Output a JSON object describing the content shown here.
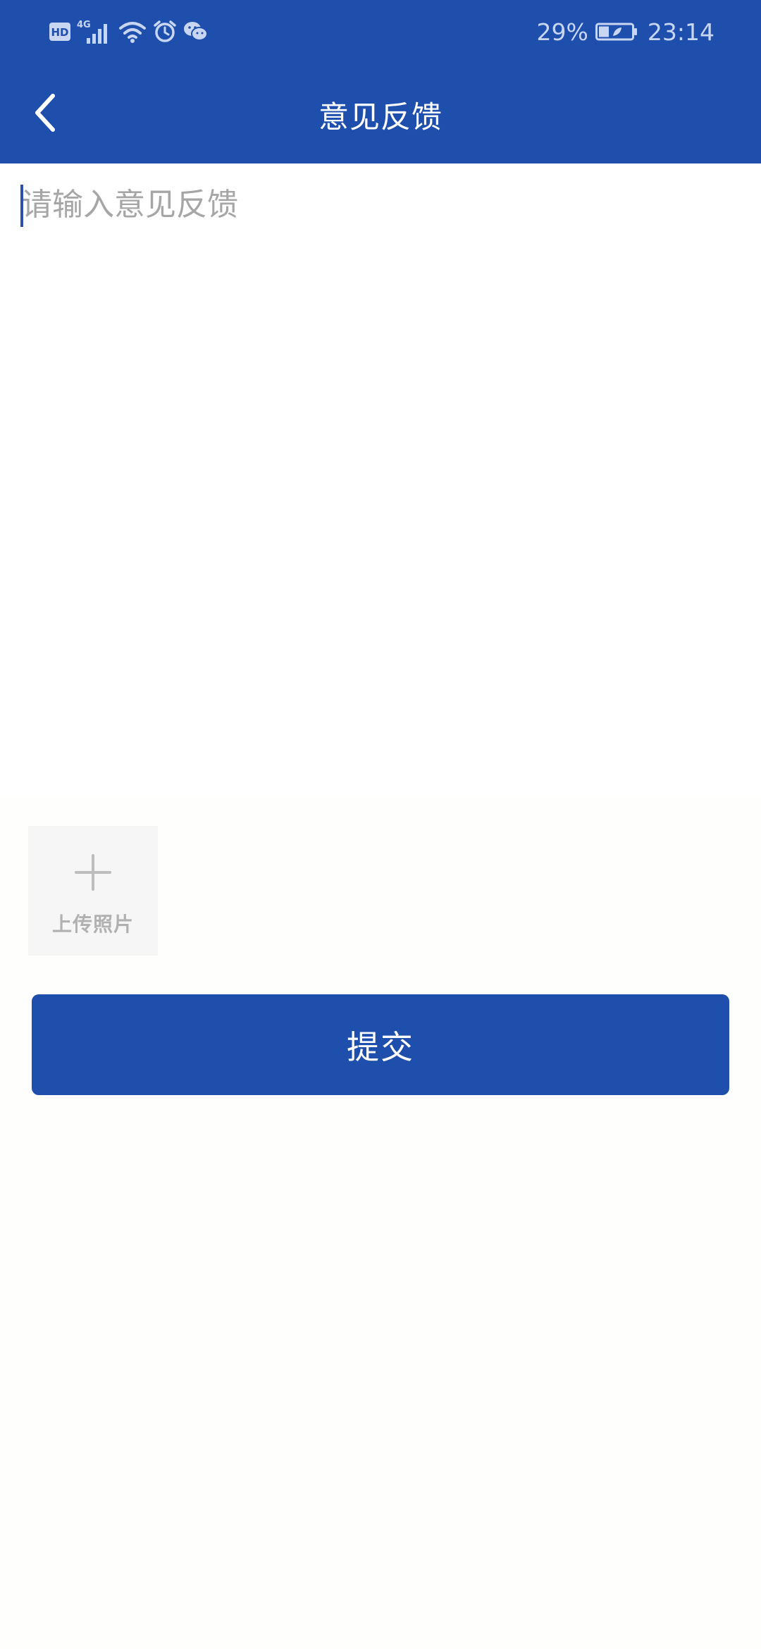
{
  "status_bar": {
    "left_icons": [
      "hd-icon",
      "4g-signal-icon",
      "wifi-icon",
      "alarm-icon",
      "wechat-icon"
    ],
    "network_label": "4G",
    "hd_label": "HD",
    "battery_percent": "29%",
    "time": "23:14"
  },
  "header": {
    "title": "意见反馈",
    "back_icon": "chevron-left-icon"
  },
  "feedback": {
    "placeholder": "请输入意见反馈",
    "value": ""
  },
  "upload": {
    "icon": "plus-icon",
    "label": "上传照片"
  },
  "submit": {
    "label": "提交"
  },
  "colors": {
    "primary": "#1f4fad",
    "placeholder": "#a6a6a6",
    "upload_bg": "#f6f6f6",
    "upload_text": "#b1b1b1"
  }
}
